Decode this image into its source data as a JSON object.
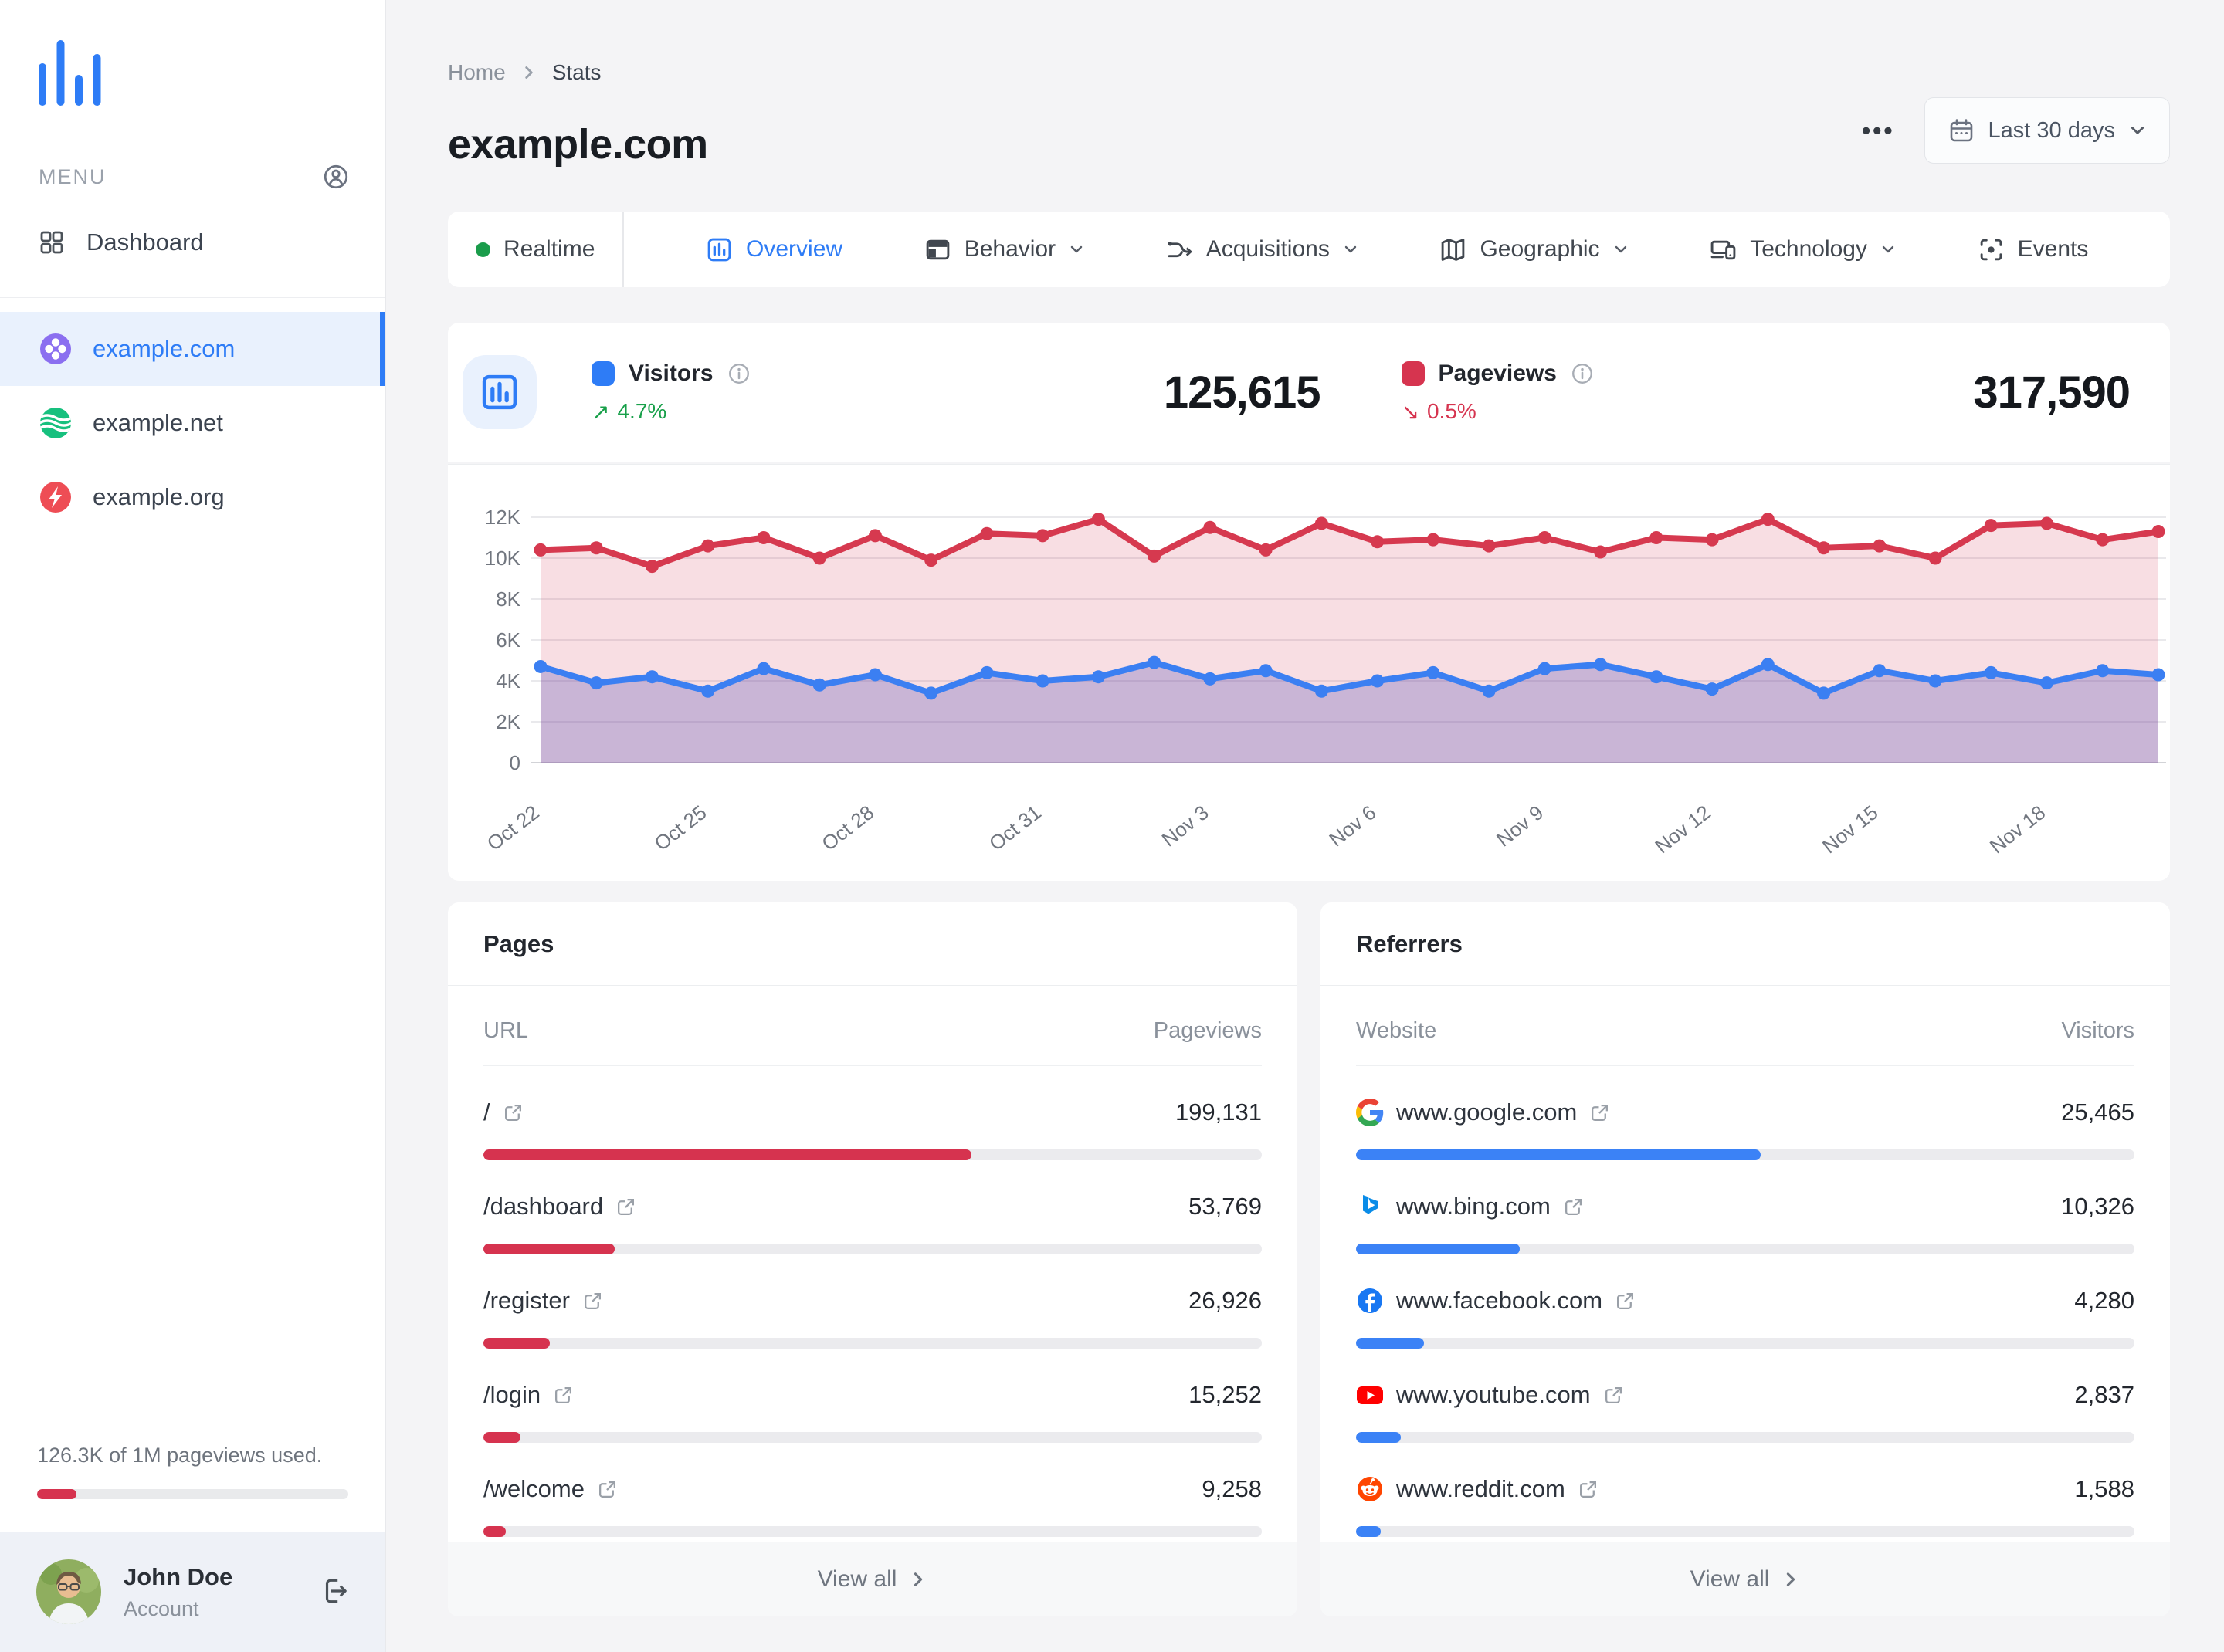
{
  "sidebar": {
    "menu_label": "MENU",
    "nav": [
      {
        "label": "Dashboard"
      }
    ],
    "sites": [
      {
        "label": "example.com",
        "active": true,
        "icon": "clover-purple"
      },
      {
        "label": "example.net",
        "active": false,
        "icon": "waves-green"
      },
      {
        "label": "example.org",
        "active": false,
        "icon": "bolt-red"
      }
    ],
    "usage": {
      "text": "126.3K of 1M pageviews used.",
      "pct": 12.6,
      "bar_color": "#d6334f"
    },
    "user": {
      "name": "John Doe",
      "role": "Account"
    }
  },
  "header": {
    "breadcrumb": {
      "home": "Home",
      "current": "Stats"
    },
    "title": "example.com",
    "overflow": "•••",
    "date_range": "Last 30 days"
  },
  "tabs": [
    {
      "label": "Realtime"
    },
    {
      "label": "Overview",
      "active": true
    },
    {
      "label": "Behavior",
      "dropdown": true
    },
    {
      "label": "Acquisitions",
      "dropdown": true
    },
    {
      "label": "Geographic",
      "dropdown": true
    },
    {
      "label": "Technology",
      "dropdown": true
    },
    {
      "label": "Events"
    }
  ],
  "stats": {
    "visitors": {
      "label": "Visitors",
      "value": "125,615",
      "change": "4.7%",
      "direction": "up",
      "color": "#2e7cf6"
    },
    "pageviews": {
      "label": "Pageviews",
      "value": "317,590",
      "change": "0.5%",
      "direction": "down",
      "color": "#d6344f"
    }
  },
  "chart_data": {
    "type": "line",
    "x": [
      "Oct 22",
      "Oct 23",
      "Oct 24",
      "Oct 25",
      "Oct 26",
      "Oct 27",
      "Oct 28",
      "Oct 29",
      "Oct 30",
      "Oct 31",
      "Nov 1",
      "Nov 2",
      "Nov 3",
      "Nov 4",
      "Nov 5",
      "Nov 6",
      "Nov 7",
      "Nov 8",
      "Nov 9",
      "Nov 10",
      "Nov 11",
      "Nov 12",
      "Nov 13",
      "Nov 14",
      "Nov 15",
      "Nov 16",
      "Nov 17",
      "Nov 18",
      "Nov 19",
      "Nov 20"
    ],
    "series": [
      {
        "name": "Pageviews",
        "color": "#d6394f",
        "area": "rgba(214,52,79,0.16)",
        "values": [
          10400,
          10500,
          9600,
          10600,
          11000,
          10000,
          11100,
          9900,
          11200,
          11100,
          11900,
          10100,
          11500,
          10400,
          11700,
          10800,
          10900,
          10600,
          11000,
          10300,
          11000,
          10900,
          11900,
          10500,
          10600,
          10000,
          11600,
          11700,
          10900,
          11300
        ]
      },
      {
        "name": "Visitors",
        "color": "#3b7ff2",
        "area": "rgba(92,86,186,0.30)",
        "values": [
          4700,
          3900,
          4200,
          3500,
          4600,
          3800,
          4300,
          3400,
          4400,
          4000,
          4200,
          4900,
          4100,
          4500,
          3500,
          4000,
          4400,
          3500,
          4600,
          4800,
          4200,
          3600,
          4800,
          3400,
          4500,
          4000,
          4400,
          3900,
          4500,
          4300
        ]
      }
    ],
    "ylim": [
      0,
      12000
    ],
    "yticks": [
      "0",
      "2K",
      "4K",
      "6K",
      "8K",
      "10K",
      "12K"
    ],
    "xtick_every": 3,
    "grid": true,
    "legend": "shown-as-stat-cards"
  },
  "pages": {
    "title": "Pages",
    "col_label": "URL",
    "col_value": "Pageviews",
    "view_all": "View all",
    "bar_color": "#d6334f",
    "rows": [
      {
        "label": "/",
        "value": "199,131",
        "pct": 62.7
      },
      {
        "label": "/dashboard",
        "value": "53,769",
        "pct": 16.9
      },
      {
        "label": "/register",
        "value": "26,926",
        "pct": 8.5
      },
      {
        "label": "/login",
        "value": "15,252",
        "pct": 4.8
      },
      {
        "label": "/welcome",
        "value": "9,258",
        "pct": 2.9
      }
    ]
  },
  "referrers": {
    "title": "Referrers",
    "col_label": "Website",
    "col_value": "Visitors",
    "view_all": "View all",
    "bar_color": "#3b82f6",
    "rows": [
      {
        "label": "www.google.com",
        "icon": "google",
        "value": "25,465",
        "pct": 52
      },
      {
        "label": "www.bing.com",
        "icon": "bing",
        "value": "10,326",
        "pct": 21
      },
      {
        "label": "www.facebook.com",
        "icon": "facebook",
        "value": "4,280",
        "pct": 8.7
      },
      {
        "label": "www.youtube.com",
        "icon": "youtube",
        "value": "2,837",
        "pct": 5.8
      },
      {
        "label": "www.reddit.com",
        "icon": "reddit",
        "value": "1,588",
        "pct": 3.2
      }
    ]
  }
}
